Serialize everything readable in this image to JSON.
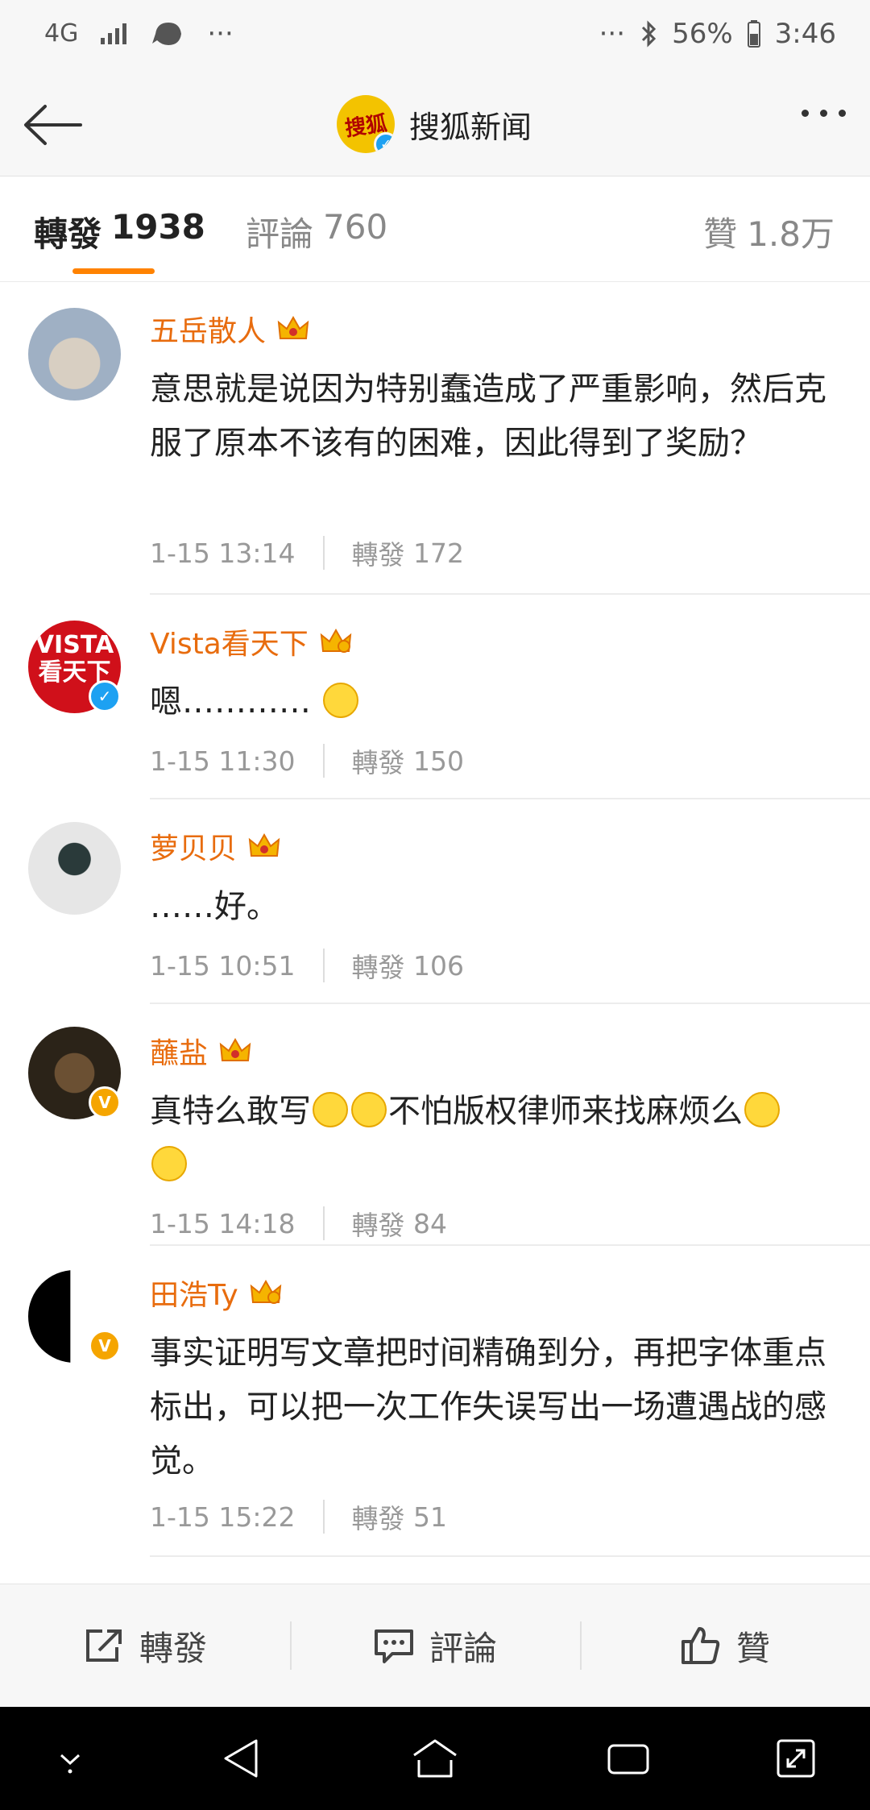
{
  "status_bar": {
    "network": "4G",
    "battery": "56%",
    "time": "3:46"
  },
  "header": {
    "title": "搜狐新闻",
    "logo_text": "搜狐"
  },
  "tabs": [
    {
      "label": "轉發",
      "count": "1938"
    },
    {
      "label": "評論",
      "count": "760"
    },
    {
      "label": "贊",
      "count": "1.8万"
    }
  ],
  "comments": [
    {
      "user": "五岳散人",
      "text": "意思就是说因为特别蠢造成了严重影响，然后克服了原本不该有的困难，因此得到了奖励？",
      "time": "1-15 13:14",
      "forward_label": "轉發",
      "forward_count": "172"
    },
    {
      "user": "Vista看天下",
      "text": "嗯…………",
      "time": "1-15 11:30",
      "forward_label": "轉發",
      "forward_count": "150"
    },
    {
      "user": "萝贝贝",
      "text": "……好。",
      "time": "1-15 10:51",
      "forward_label": "轉發",
      "forward_count": "106"
    },
    {
      "user": "蘸盐",
      "text_a": "真特么敢写",
      "text_b": "不怕版权律师来找麻烦么",
      "time": "1-15 14:18",
      "forward_label": "轉發",
      "forward_count": "84"
    },
    {
      "user": "田浩Ty",
      "text": "事实证明写文章把时间精确到分，再把字体重点标出，可以把一次工作失误写出一场遭遇战的感觉。",
      "time": "1-15 15:22",
      "forward_label": "轉發",
      "forward_count": "51"
    }
  ],
  "bottom_bar": {
    "forward": "轉發",
    "comment": "評論",
    "like": "贊"
  },
  "avatars": {
    "vista_text_a": "VISTA",
    "vista_text_b": "看天下"
  },
  "colors": {
    "accent": "#ff8200",
    "username": "#e86c0e",
    "verified_blue": "#1da1f2",
    "verified_orange": "#f5a500"
  }
}
